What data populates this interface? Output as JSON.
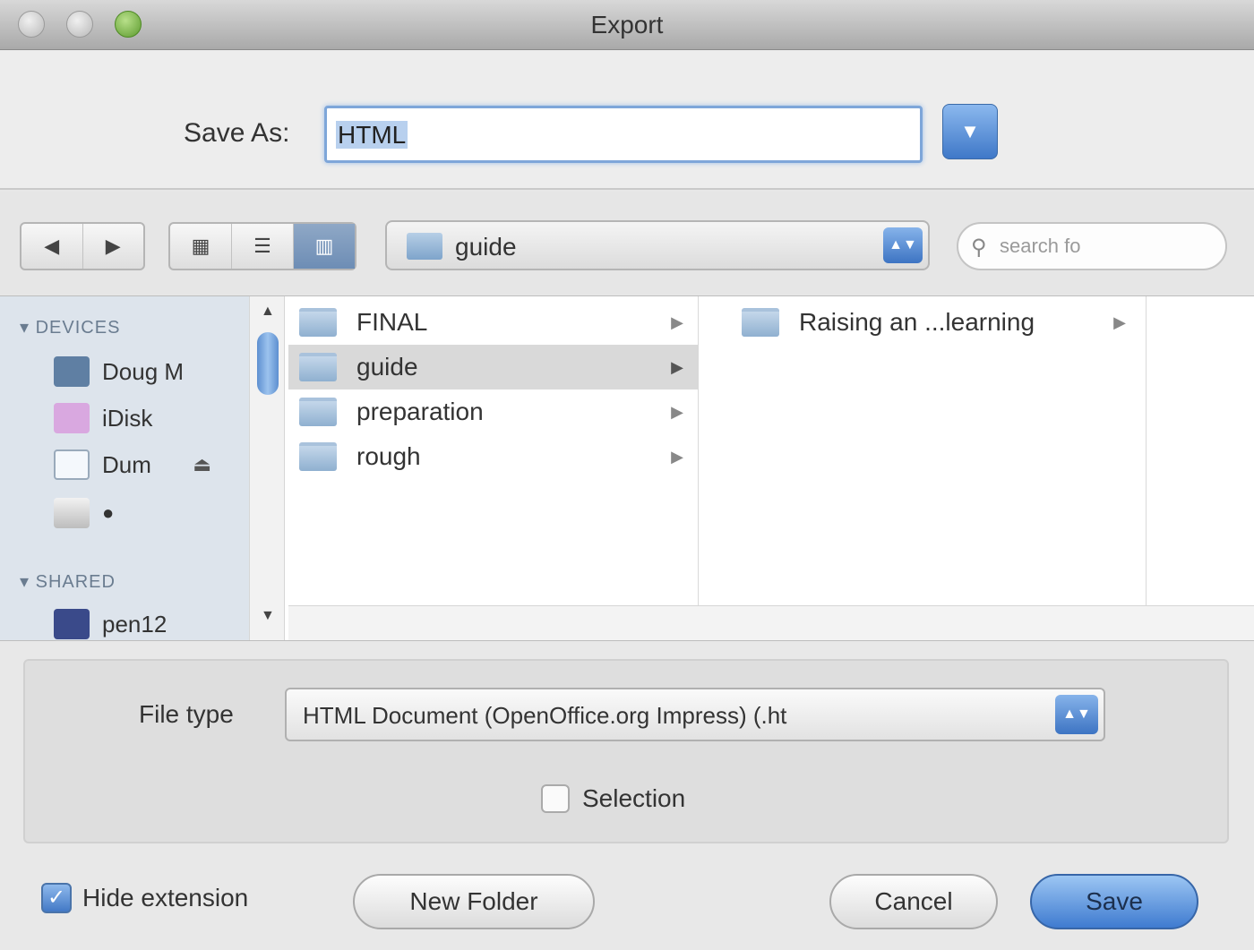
{
  "window": {
    "title": "Export"
  },
  "save_as": {
    "label": "Save As:",
    "selected_value": "HTML",
    "value": ""
  },
  "toolbar": {
    "nav": [
      "◀",
      "▶"
    ],
    "views": [
      "▦",
      "☰",
      "▥"
    ],
    "location": "guide",
    "search_placeholder": "search fo"
  },
  "sidebar": {
    "devices_header": "DEVICES",
    "devices": [
      {
        "label": "Doug M",
        "icon": "computer-icon",
        "color": "#5f7fa3"
      },
      {
        "label": "iDisk",
        "icon": "idisk-icon",
        "color": "#d9a8e0"
      },
      {
        "label": "Dum",
        "icon": "disk-icon",
        "color": "#f4f8fc",
        "eject": "⏏"
      },
      {
        "label": "",
        "icon": "apple-disk-icon",
        "color": "#d8d8d8",
        "glyph": "●"
      }
    ],
    "shared_header": "SHARED",
    "shared": [
      {
        "label": "pen12",
        "icon": "network-computer-icon",
        "color": "#3a4a8a"
      }
    ]
  },
  "browser": {
    "column1": [
      {
        "name": "FINAL",
        "selected": false
      },
      {
        "name": "guide",
        "selected": true
      },
      {
        "name": "preparation",
        "selected": false
      },
      {
        "name": "rough",
        "selected": false
      }
    ],
    "column2": [
      {
        "name": "Raising an ...learning",
        "selected": false
      }
    ]
  },
  "options": {
    "file_type_label": "File type",
    "file_type_value": "HTML Document (OpenOffice.org Impress) (.ht",
    "selection_label": "Selection"
  },
  "bottom": {
    "hide_extension_label": "Hide extension",
    "new_folder_label": "New Folder",
    "cancel_label": "Cancel",
    "save_label": "Save"
  }
}
